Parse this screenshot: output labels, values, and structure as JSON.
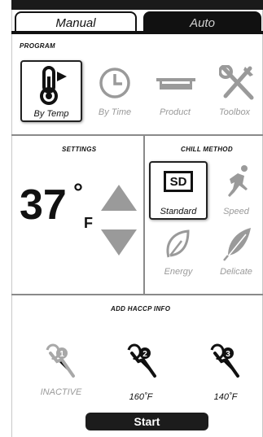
{
  "tabs": {
    "manual": "Manual",
    "auto": "Auto"
  },
  "program": {
    "title": "PROGRAM",
    "items": [
      {
        "label": "By Temp",
        "icon": "thermometer-icon",
        "selected": true
      },
      {
        "label": "By Time",
        "icon": "clock-icon",
        "selected": false
      },
      {
        "label": "Product",
        "icon": "tray-icon",
        "selected": false
      },
      {
        "label": "Toolbox",
        "icon": "tools-icon",
        "selected": false
      }
    ]
  },
  "settings": {
    "title": "SETTINGS",
    "value": "37",
    "degree": "°",
    "unit": "F"
  },
  "chill": {
    "title": "CHILL METHOD",
    "items": [
      {
        "label": "Standard",
        "badge": "SD",
        "icon": "sd-icon",
        "selected": true
      },
      {
        "label": "Speed",
        "icon": "runner-icon",
        "selected": false
      },
      {
        "label": "Energy",
        "icon": "leaf-icon",
        "selected": false
      },
      {
        "label": "Delicate",
        "icon": "feather-icon",
        "selected": false
      }
    ]
  },
  "haccp": {
    "title": "ADD HACCP INFO",
    "probes": [
      {
        "number": "1",
        "label": "INACTIVE",
        "active": false,
        "icon": "probe-icon"
      },
      {
        "number": "2",
        "label": "160˚F",
        "active": true,
        "icon": "probe-icon"
      },
      {
        "number": "3",
        "label": "140˚F",
        "active": true,
        "icon": "probe-icon"
      }
    ]
  },
  "start_label": "Start",
  "colors": {
    "dark": "#111111",
    "inactive": "#9a9a9a",
    "divider": "#8a8a8a"
  }
}
